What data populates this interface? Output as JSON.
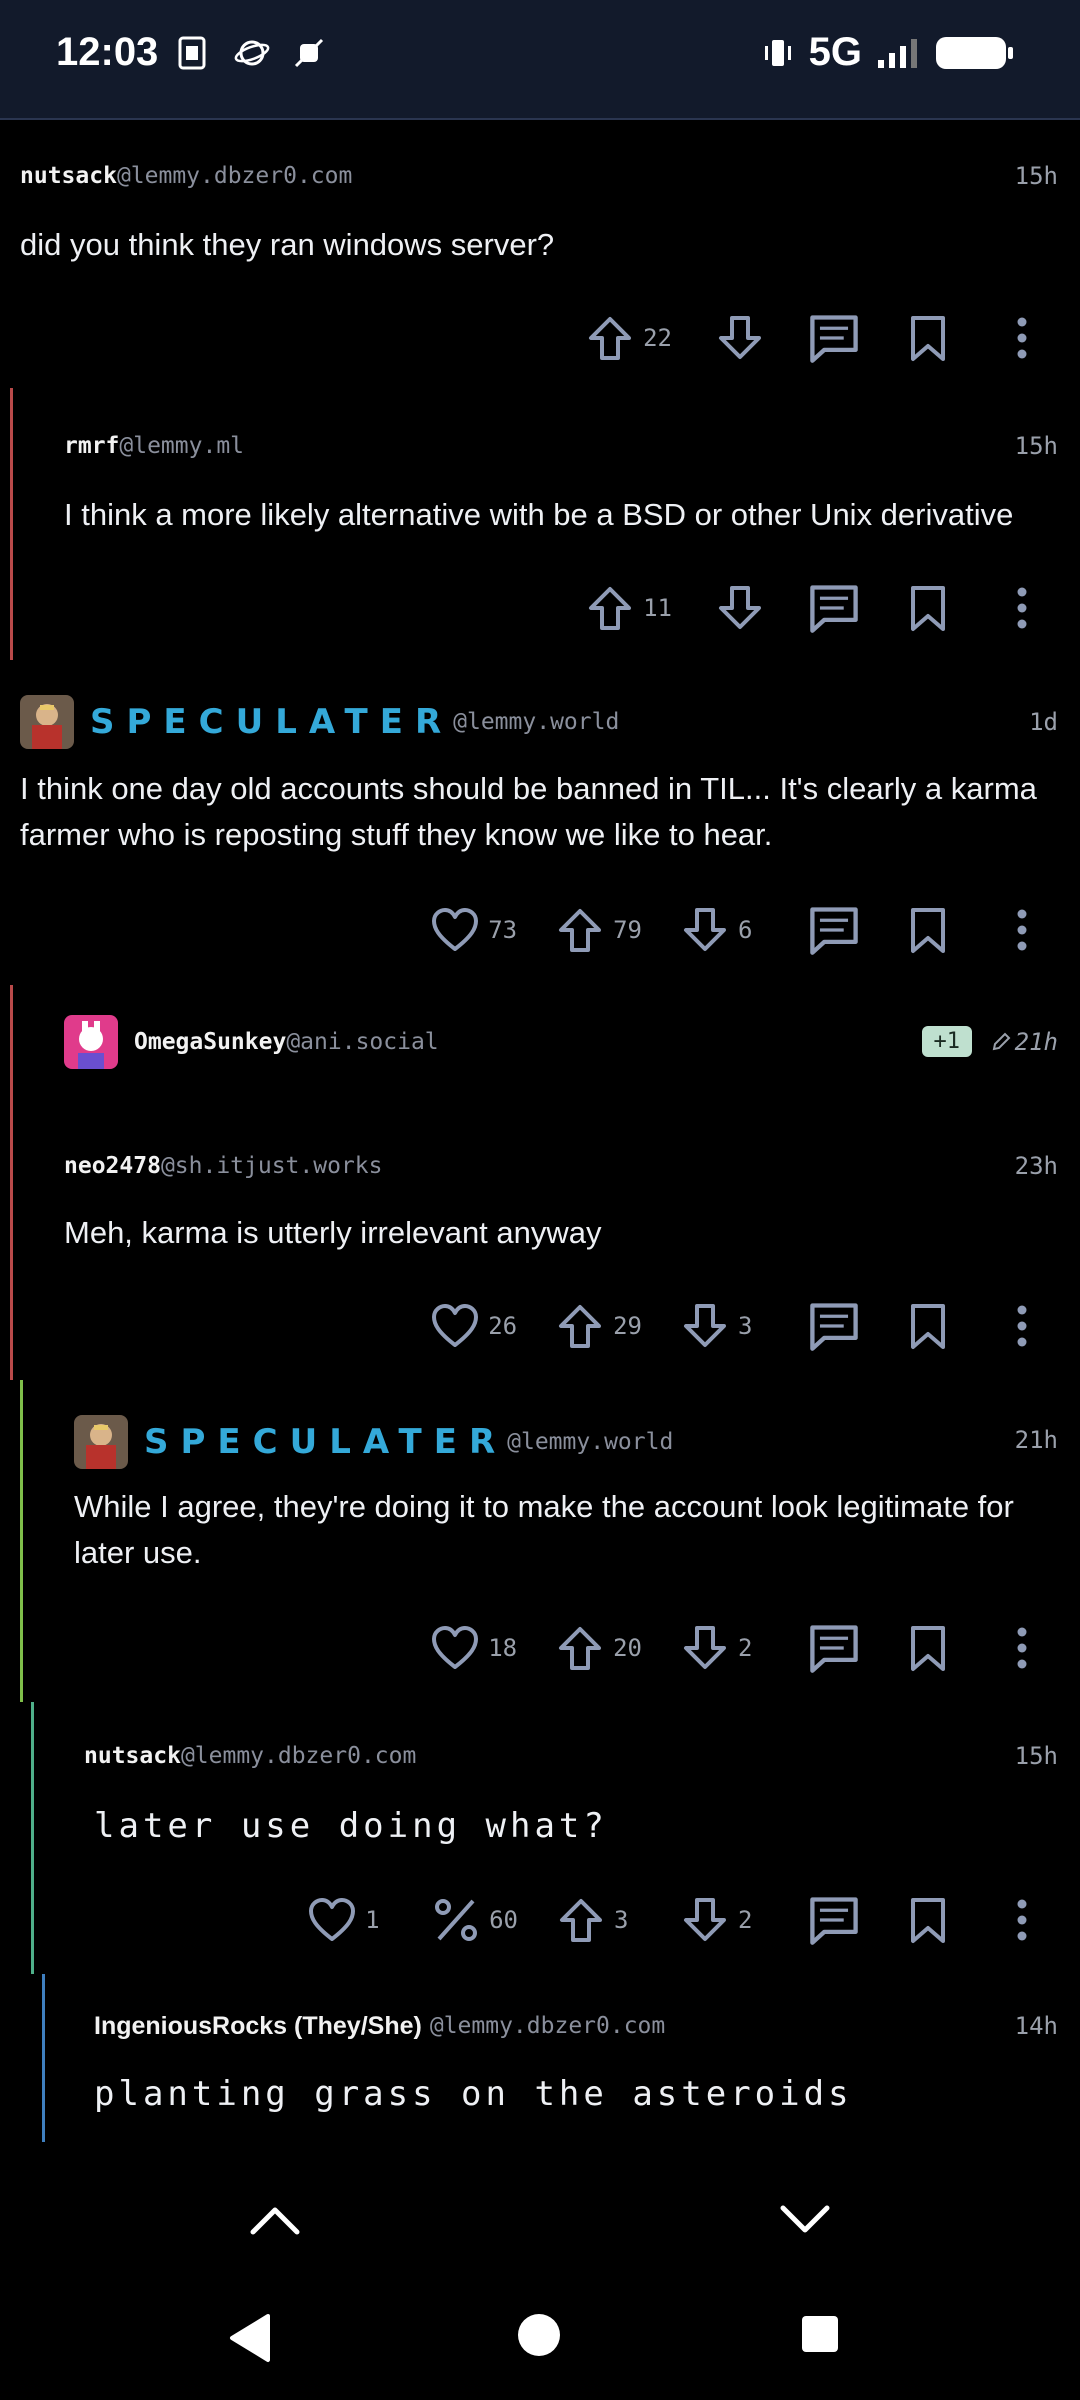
{
  "status_bar": {
    "time": "12:03",
    "network": "5G"
  },
  "comments": [
    {
      "user": "nutsack",
      "instance": "@lemmy.dbzer0.com",
      "time": "15h",
      "text": "did you think they ran windows server?",
      "up": "22"
    },
    {
      "user": "rmrf",
      "instance": "@lemmy.ml",
      "time": "15h",
      "text": "I think a more likely alternative with be a BSD or other Unix derivative",
      "up": "11"
    },
    {
      "user": "SPECULATER",
      "instance": "@lemmy.world",
      "time": "1d",
      "text": "I think one day old accounts should be banned in TIL... It's clearly a karma farmer who is reposting stuff they know we like to hear.",
      "likes": "73",
      "up": "79",
      "down": "6"
    },
    {
      "user": "OmegaSunkey",
      "instance": "@ani.social",
      "badge": "+1",
      "time": "21h"
    },
    {
      "user": "neo2478",
      "instance": "@sh.itjust.works",
      "time": "23h",
      "text": "Meh, karma is utterly irrelevant anyway",
      "likes": "26",
      "up": "29",
      "down": "3"
    },
    {
      "user": "SPECULATER",
      "instance": "@lemmy.world",
      "time": "21h",
      "text": "While I agree, they're doing it to make the account look legitimate for later use.",
      "likes": "18",
      "up": "20",
      "down": "2"
    },
    {
      "user": "nutsack",
      "instance": "@lemmy.dbzer0.com",
      "time": "15h",
      "text": "later use doing what?",
      "likes": "1",
      "percent": "60",
      "up": "3",
      "down": "2"
    },
    {
      "user": "IngeniousRocks (They/She)",
      "instance": "@lemmy.dbzer0.com",
      "time": "14h",
      "text": "planting grass on the asteroids"
    }
  ],
  "colors": {
    "thread_red": "#b94a4a",
    "thread_green": "#7fbf4a",
    "thread_teal": "#4fb08a",
    "thread_blue": "#3f7fbf",
    "accent_blue": "#34a9d9",
    "icon": "#8f9bb6"
  }
}
